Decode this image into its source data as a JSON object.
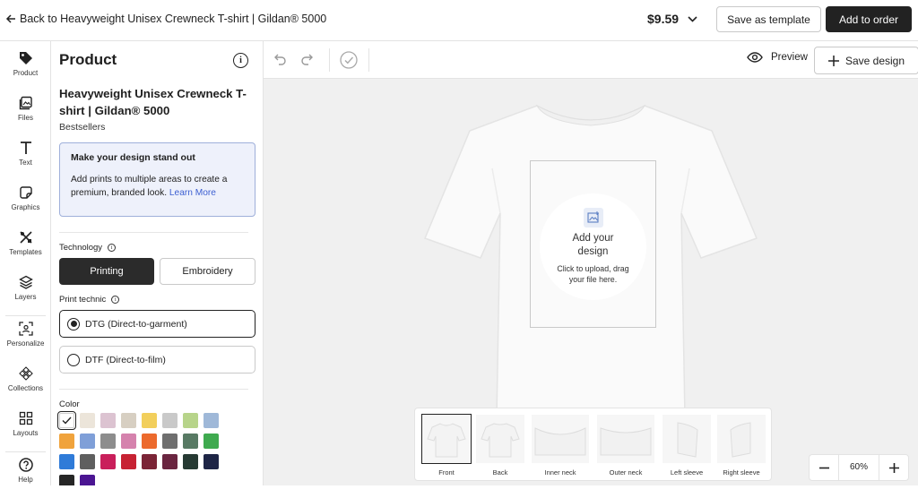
{
  "topbar": {
    "back_label": "Back to Heavyweight Unisex Crewneck T-shirt | Gildan® 5000",
    "price": "$9.59",
    "save_template": "Save as template",
    "add_to_order": "Add to order"
  },
  "rail": {
    "items": [
      {
        "label": "Product",
        "icon": "tag-icon"
      },
      {
        "label": "Files",
        "icon": "files-icon"
      },
      {
        "label": "Text",
        "icon": "text-icon"
      },
      {
        "label": "Graphics",
        "icon": "graphics-icon"
      },
      {
        "label": "Templates",
        "icon": "templates-icon"
      },
      {
        "label": "Layers",
        "icon": "layers-icon"
      },
      {
        "label": "Personalize",
        "icon": "personalize-icon"
      },
      {
        "label": "Collections",
        "icon": "collections-icon"
      },
      {
        "label": "Layouts",
        "icon": "layouts-icon"
      },
      {
        "label": "Help",
        "icon": "help-icon"
      }
    ]
  },
  "panel": {
    "title": "Product",
    "product_name": "Heavyweight Unisex Crewneck T-shirt | Gildan® 5000",
    "category": "Bestsellers",
    "promo": {
      "title": "Make your design stand out",
      "body": "Add prints to multiple areas to create a premium, branded look.",
      "link": "Learn More"
    },
    "technology_label": "Technology",
    "technology_options": [
      "Printing",
      "Embroidery"
    ],
    "technology_selected": "Printing",
    "print_technic_label": "Print technic",
    "print_technic_options": [
      "DTG (Direct-to-garment)",
      "DTF (Direct-to-film)"
    ],
    "print_technic_selected": "DTG (Direct-to-garment)",
    "color_label": "Color",
    "colors": [
      "#ffffff",
      "#ece5da",
      "#dcc3d1",
      "#d7cfc2",
      "#f2cf5c",
      "#c9c9c9",
      "#b7d48a",
      "#9fb8d8",
      "#f0a33c",
      "#7f9fd8",
      "#8d8d8d",
      "#d582ad",
      "#ec6a2d",
      "#6f6f6f",
      "#587a64",
      "#3faa4f",
      "#2f7bd8",
      "#5f5f5f",
      "#c91f5b",
      "#c72233",
      "#7b2436",
      "#6a2540",
      "#263a33",
      "#1e2546",
      "#262626",
      "#4b1592"
    ]
  },
  "toolbar": {
    "preview": "Preview",
    "save_design": "Save design"
  },
  "canvas": {
    "upload_title": "Add your design",
    "upload_sub": "Click to upload, drag your file here."
  },
  "views": [
    {
      "label": "Front"
    },
    {
      "label": "Back"
    },
    {
      "label": "Inner neck"
    },
    {
      "label": "Outer neck"
    },
    {
      "label": "Left sleeve"
    },
    {
      "label": "Right sleeve"
    }
  ],
  "zoom": {
    "value": "60%"
  }
}
